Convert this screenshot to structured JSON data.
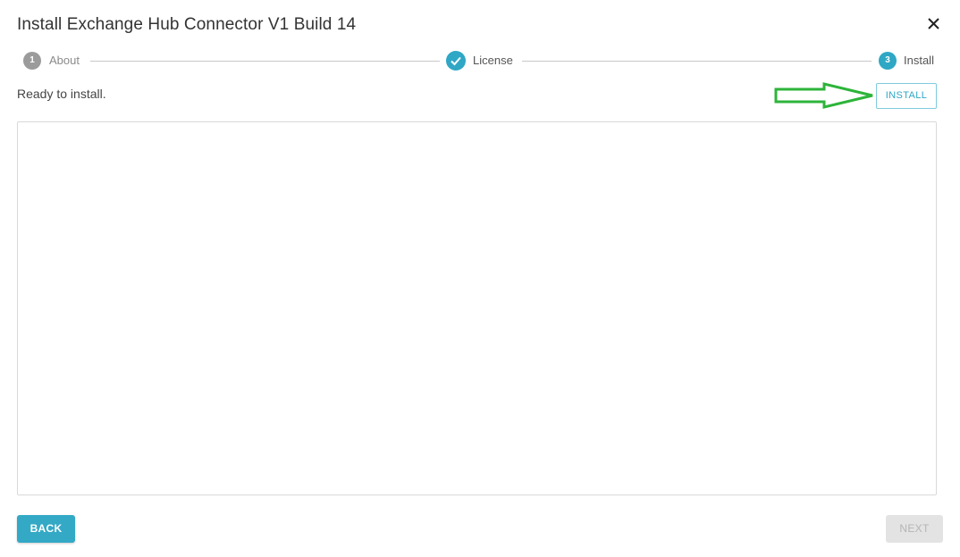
{
  "dialog": {
    "title": "Install Exchange Hub Connector V1 Build 14",
    "close_icon": "close-icon"
  },
  "stepper": {
    "steps": [
      {
        "number": "1",
        "label": "About",
        "state": "inactive"
      },
      {
        "number": "",
        "label": "License",
        "state": "completed",
        "icon": "check-icon"
      },
      {
        "number": "3",
        "label": "Install",
        "state": "active"
      }
    ]
  },
  "status": {
    "text": "Ready to install."
  },
  "actions": {
    "install_label": "INSTALL",
    "back_label": "BACK",
    "next_label": "NEXT"
  },
  "annotation": {
    "arrow_icon": "right-arrow-icon",
    "arrow_color": "#2db43a"
  },
  "colors": {
    "accent": "#2fa7c5",
    "step_inactive": "#9b9b9b",
    "button_disabled_bg": "#e3e3e3"
  }
}
